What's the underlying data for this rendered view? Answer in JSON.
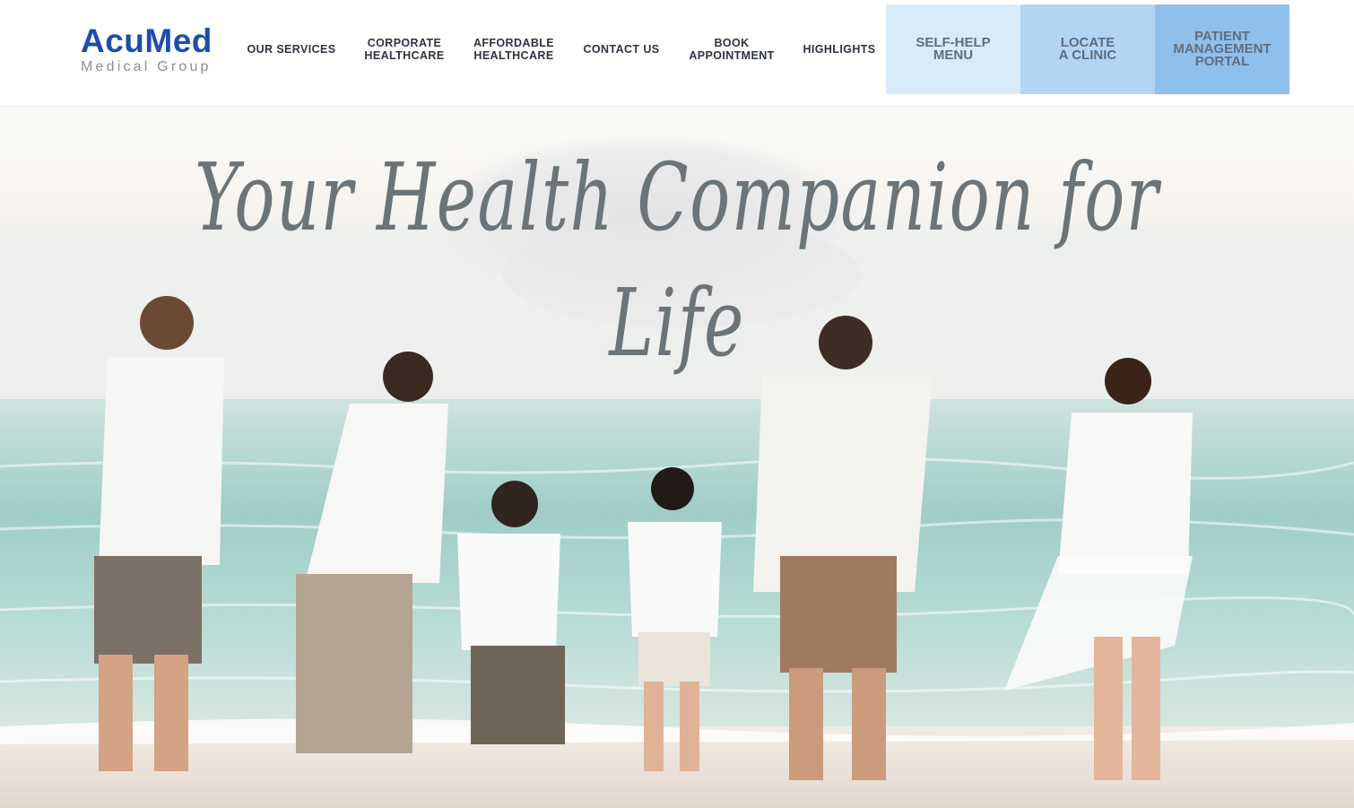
{
  "brand": {
    "name": "AcuMed",
    "subtitle": "Medical Group",
    "color": "#1d4eaa"
  },
  "nav": {
    "items": [
      {
        "label": "OUR SERVICES"
      },
      {
        "label": "CORPORATE\nHEALTHCARE"
      },
      {
        "label": "AFFORDABLE\nHEALTHCARE"
      },
      {
        "label": "CONTACT US"
      },
      {
        "label": "BOOK\nAPPOINTMENT"
      },
      {
        "label": "HIGHLIGHTS"
      }
    ],
    "cta": [
      {
        "label": "SELF-HELP\nMENU",
        "bg": "#d9eafa"
      },
      {
        "label": "LOCATE\nA CLINIC",
        "bg": "#b3d4f3"
      },
      {
        "label": "PATIENT\nMANAGEMENT\nPORTAL",
        "bg": "#8fc0eb"
      }
    ]
  },
  "hero": {
    "tagline": "Your Health Companion for Life",
    "image_description_icon": "family-beach-photo"
  }
}
